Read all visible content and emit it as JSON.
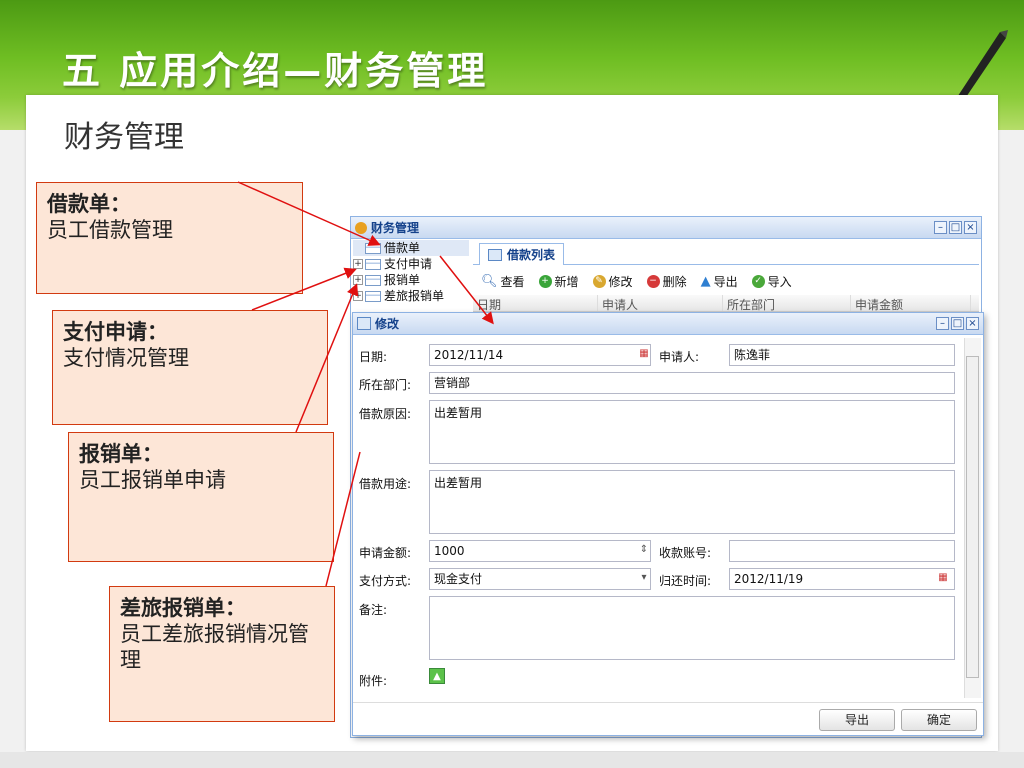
{
  "slide": {
    "title": "五 应用介绍—财务管理",
    "subtitle": "财务管理"
  },
  "callouts": [
    {
      "title": "借款单：",
      "desc": "员工借款管理"
    },
    {
      "title": "支付申请：",
      "desc": "支付情况管理"
    },
    {
      "title": "报销单：",
      "desc": "员工报销单申请"
    },
    {
      "title": "差旅报销单：",
      "desc": "员工差旅报销情况管理"
    }
  ],
  "app": {
    "window_title": "财务管理",
    "tree": [
      "借款单",
      "支付申请",
      "报销单",
      "差旅报销单"
    ],
    "tab_label": "借款列表",
    "toolbar": [
      "查看",
      "新增",
      "修改",
      "删除",
      "导出",
      "导入"
    ],
    "grid_headers": [
      "日期",
      "申请人",
      "所在部门",
      "申请金额"
    ]
  },
  "dialog": {
    "title": "修改",
    "labels": {
      "date": "日期:",
      "applicant": "申请人:",
      "dept": "所在部门:",
      "reason": "借款原因:",
      "purpose": "借款用途:",
      "amount": "申请金额:",
      "account": "收款账号:",
      "paymethod": "支付方式:",
      "returntime": "归还时间:",
      "remark": "备注:",
      "attach": "附件:"
    },
    "values": {
      "date": "2012/11/14",
      "applicant": "陈逸菲",
      "dept": "营销部",
      "reason": "出差暂用",
      "purpose": "出差暂用",
      "amount": "1000",
      "account": "",
      "paymethod": "现金支付",
      "returntime": "2012/11/19",
      "remark": ""
    },
    "buttons": {
      "export": "导出",
      "confirm": "确定"
    }
  },
  "colors": {
    "accent_green": "#6fbe23",
    "callout_border": "#d23a10",
    "callout_bg": "#fde6d7",
    "window_border": "#8db2e3"
  }
}
